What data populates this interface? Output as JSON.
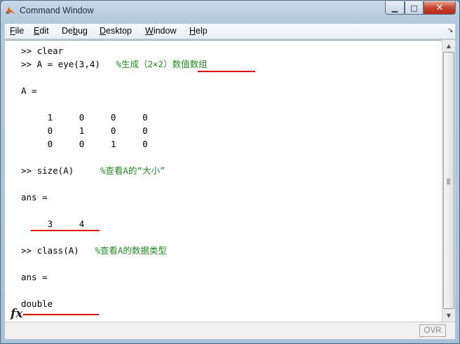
{
  "window": {
    "title": "Command Window"
  },
  "menu": {
    "items": [
      {
        "first": "F",
        "rest": "ile"
      },
      {
        "first": "E",
        "rest": "dit"
      },
      {
        "pre": "De",
        "first": "b",
        "rest": "ug"
      },
      {
        "first": "D",
        "rest": "esktop"
      },
      {
        "first": "W",
        "rest": "indow"
      },
      {
        "first": "H",
        "rest": "elp"
      }
    ]
  },
  "console": {
    "lines": [
      {
        "code": ">> clear",
        "comment": ""
      },
      {
        "code": ">> A = eye(3,4)   ",
        "comment": "%生成（2×2）数值数组"
      },
      {
        "code": "",
        "comment": ""
      },
      {
        "code": "A =",
        "comment": ""
      },
      {
        "code": "",
        "comment": ""
      },
      {
        "code": "     1     0     0     0",
        "comment": ""
      },
      {
        "code": "     0     1     0     0",
        "comment": ""
      },
      {
        "code": "     0     0     1     0",
        "comment": ""
      },
      {
        "code": "",
        "comment": ""
      },
      {
        "code": ">> size(A)     ",
        "comment": "%查看A的“大小”"
      },
      {
        "code": "",
        "comment": ""
      },
      {
        "code": "ans =",
        "comment": ""
      },
      {
        "code": "",
        "comment": ""
      },
      {
        "code": "     3     4",
        "comment": ""
      },
      {
        "code": "",
        "comment": ""
      },
      {
        "code": ">> class(A)   ",
        "comment": "%查看A的数据类型"
      },
      {
        "code": "",
        "comment": ""
      },
      {
        "code": "ans =",
        "comment": ""
      },
      {
        "code": "",
        "comment": ""
      },
      {
        "code": "double",
        "comment": ""
      }
    ]
  },
  "prompt": {
    "icon": "fx-icon",
    "label": "fx"
  },
  "status": {
    "ovr": "OVR"
  }
}
